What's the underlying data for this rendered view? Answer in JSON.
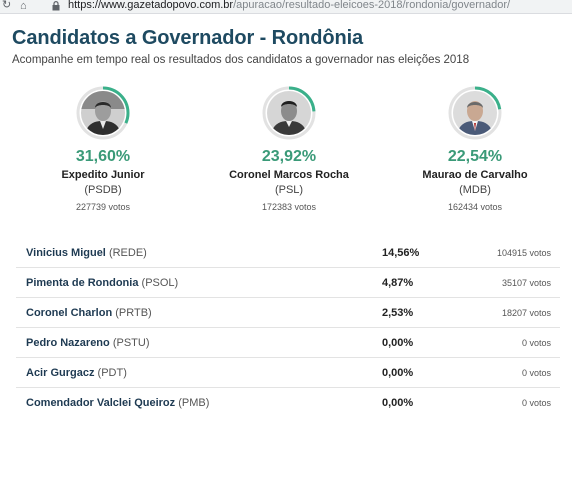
{
  "browser": {
    "url_host": "https://www.gazetadopovo.com.br",
    "url_path": "/apuracao/resultado-eleicoes-2018/rondonia/governador/"
  },
  "page": {
    "title": "Candidatos a Governador - Rondônia",
    "subtitle": "Acompanhe em tempo real os resultados dos candidatos a governador nas eleições 2018"
  },
  "colors": {
    "title": "#1e4a61",
    "percent": "#3a9a78",
    "ring_progress": "#3ab08a",
    "ring_track": "#e2e2e2"
  },
  "top_candidates": [
    {
      "percent": "31,60%",
      "share": 0.316,
      "name": "Expedito Junior",
      "party": "(PSDB)",
      "votes": "227739 votos"
    },
    {
      "percent": "23,92%",
      "share": 0.2392,
      "name": "Coronel Marcos Rocha",
      "party": "(PSL)",
      "votes": "172383 votos"
    },
    {
      "percent": "22,54%",
      "share": 0.2254,
      "name": "Maurao de Carvalho",
      "party": "(MDB)",
      "votes": "162434 votos"
    }
  ],
  "other_candidates": [
    {
      "name": "Vinicius Miguel",
      "party": "(REDE)",
      "percent": "14,56%",
      "votes": "104915 votos"
    },
    {
      "name": "Pimenta de Rondonia",
      "party": "(PSOL)",
      "percent": "4,87%",
      "votes": "35107 votos"
    },
    {
      "name": "Coronel Charlon",
      "party": "(PRTB)",
      "percent": "2,53%",
      "votes": "18207 votos"
    },
    {
      "name": "Pedro Nazareno",
      "party": "(PSTU)",
      "percent": "0,00%",
      "votes": "0 votos"
    },
    {
      "name": "Acir Gurgacz",
      "party": "(PDT)",
      "percent": "0,00%",
      "votes": "0 votos"
    },
    {
      "name": "Comendador Valclei Queiroz",
      "party": "(PMB)",
      "percent": "0,00%",
      "votes": "0 votos"
    }
  ]
}
